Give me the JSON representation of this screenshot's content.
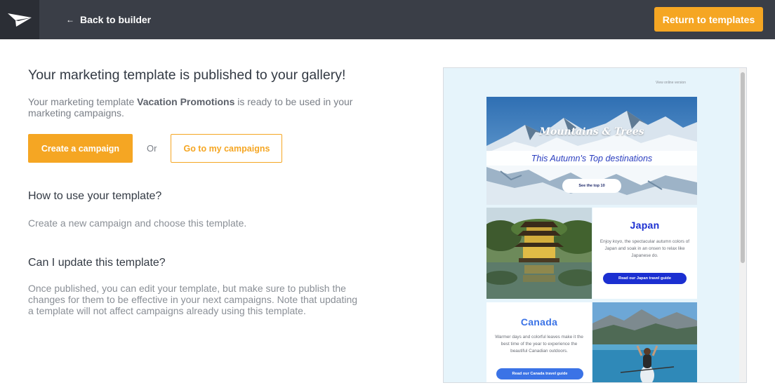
{
  "header": {
    "back_label": "Back to builder",
    "return_label": "Return to templates"
  },
  "main": {
    "title": "Your marketing template is published to your gallery!",
    "intro_prefix": "Your marketing template ",
    "template_name": "Vacation Promotions",
    "intro_suffix": " is ready to be used in your marketing campaigns.",
    "create_label": "Create a campaign",
    "or_label": "Or",
    "go_label": "Go to my campaigns",
    "howto_title": "How to use your template?",
    "howto_text": "Create a new campaign and choose this template.",
    "update_title": "Can I update this template?",
    "update_text": "Once published, you can edit your template, but make sure to publish the changes for them to be effective in your next campaigns. Note that updating a template will not affect campaigns already using this template."
  },
  "preview": {
    "view_online": "View online version",
    "hero_title": "Mountains & Trees",
    "hero_subtitle": "This Autumn's Top destinations",
    "hero_button": "See the top 10",
    "japan": {
      "title": "Japan",
      "text_before": "Enjoy ",
      "text_em": "koyo",
      "text_after": ", the spectacular autumn colors of Japan and soak in an onsen to relax like Japanese do.",
      "button": "Read our Japan travel guide"
    },
    "canada": {
      "title": "Canada",
      "text": "Warmer days and colorful leaves make it the best time of the year to experience the beautiful Canadian outdoors.",
      "button": "Read our Canada travel guide"
    }
  },
  "colors": {
    "topbar": "#3a3e47",
    "accent": "#f5a623",
    "japan_blue": "#1b2fd1",
    "canada_blue": "#3b73e6"
  }
}
